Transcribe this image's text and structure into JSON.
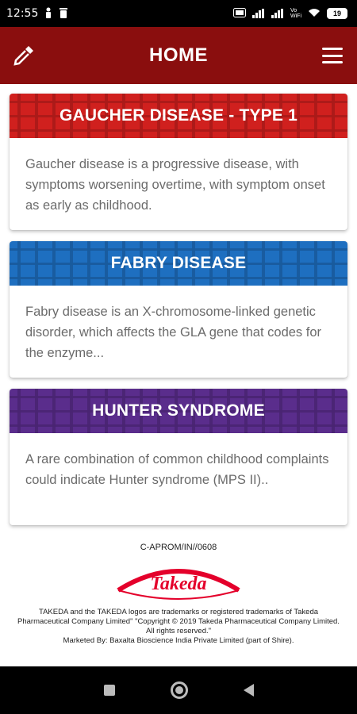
{
  "status": {
    "time": "12:55",
    "battery": "19",
    "net_label": "Vo\nWiFi"
  },
  "app_bar": {
    "title": "HOME"
  },
  "cards": [
    {
      "title": "GAUCHER DISEASE - TYPE 1",
      "body": "Gaucher disease is a progressive disease, with symptoms worsening overtime, with symptom onset as early as childhood.",
      "color": "#d0201e"
    },
    {
      "title": "FABRY DISEASE",
      "body": "Fabry disease is an X-chromosome-linked genetic disorder, which affects the GLA gene that codes for the enzyme...",
      "color": "#1e6fc0"
    },
    {
      "title": "HUNTER SYNDROME",
      "body": "A rare combination of common childhood complaints could indicate Hunter syndrome (MPS II)..",
      "color": "#5a2d8c"
    }
  ],
  "footer": {
    "code": "C-APROM/IN//0608",
    "logo_text": "Takeda",
    "legal_1": "TAKEDA and the TAKEDA logos are trademarks or registered trademarks of Takeda Pharmaceutical Company Limited\" \"Copyright © 2019 Takeda Pharmaceutical Company Limited. All rights reserved.\"",
    "legal_2": "Marketed By: Baxalta Bioscience India Private Limited (part of Shire)."
  }
}
